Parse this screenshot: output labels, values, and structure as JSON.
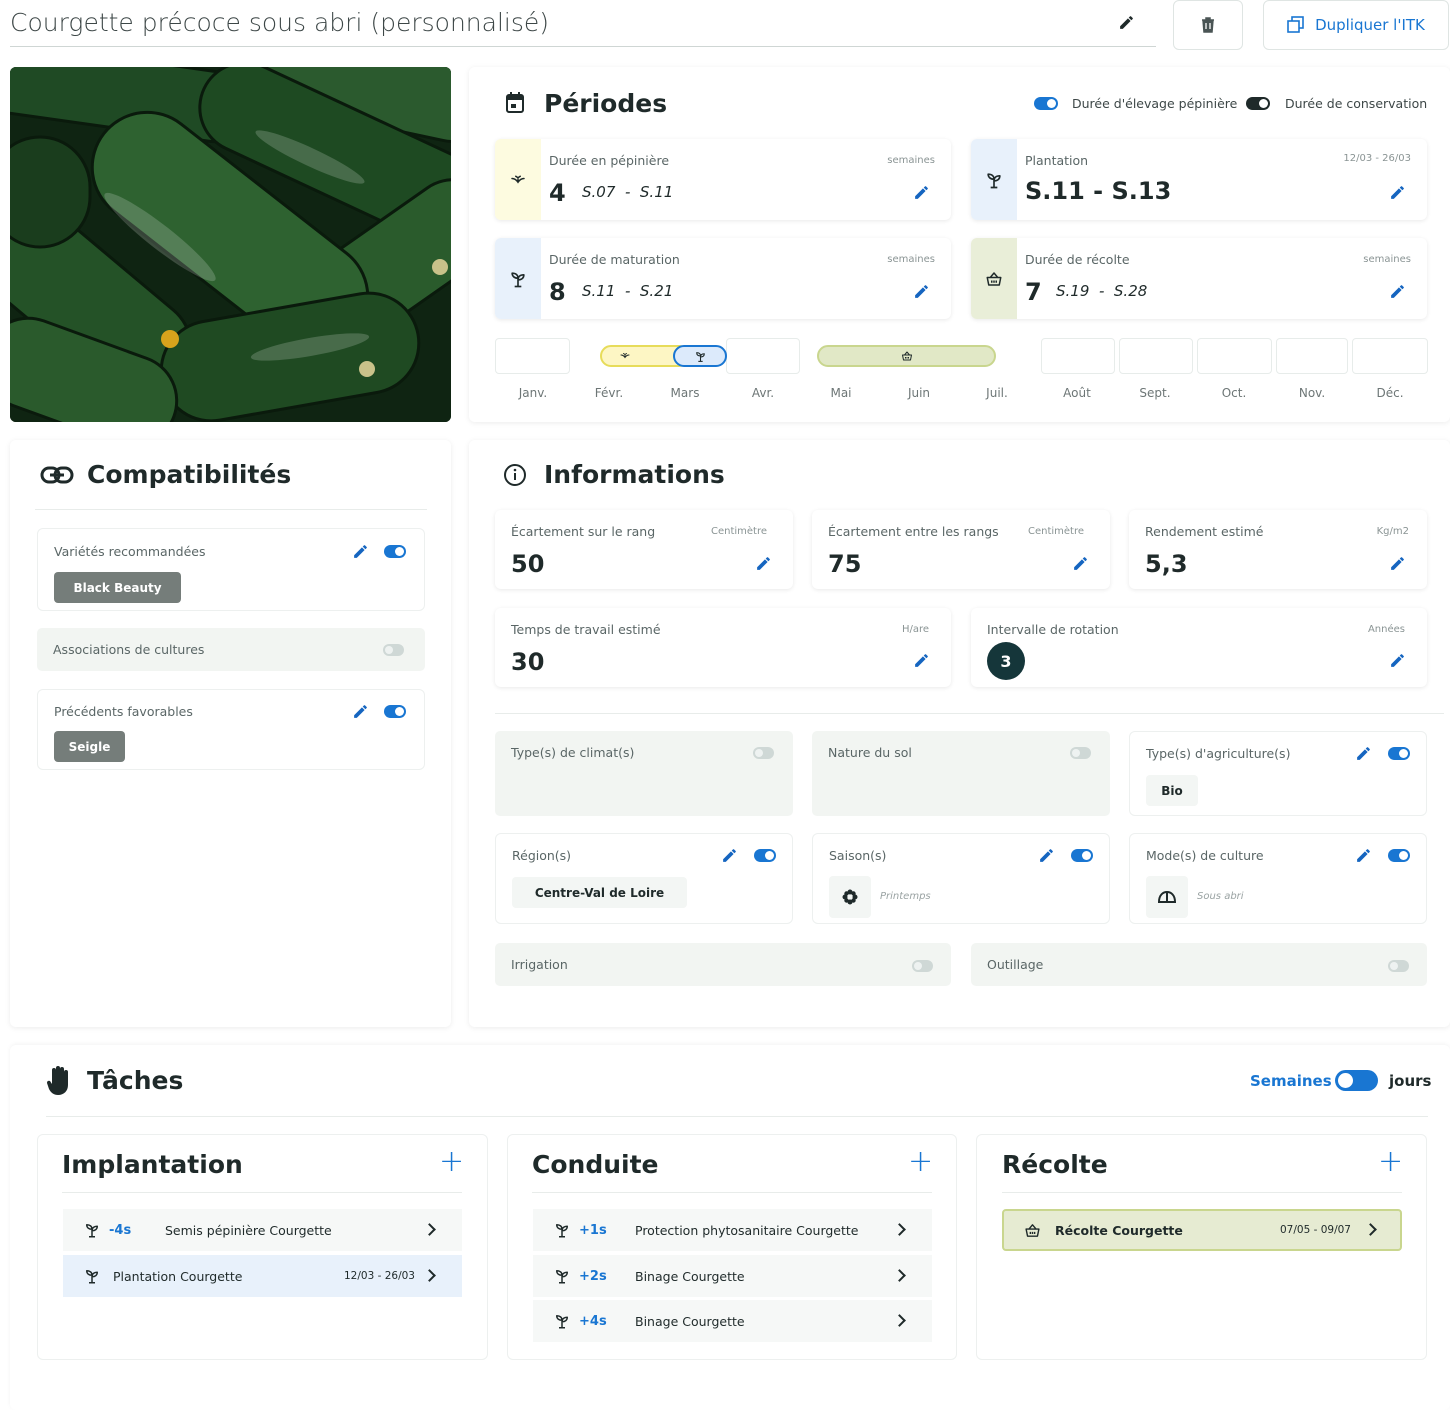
{
  "header": {
    "title": "Courgette précoce sous abri (personnalisé)",
    "duplicate_label": "Dupliquer l'ITK"
  },
  "periodes": {
    "title": "Périodes",
    "toggle_pepiniere": "Durée d'élevage pépinière",
    "toggle_conservation": "Durée de conservation",
    "cards": {
      "pepiniere": {
        "label": "Durée en pépinière",
        "unit": "semaines",
        "value": "4",
        "start": "S.07",
        "sep": "-",
        "end": "S.11"
      },
      "plantation": {
        "label": "Plantation",
        "dates": "12/03 - 26/03",
        "start": "S.11",
        "sep": "-",
        "end": "S.13"
      },
      "maturation": {
        "label": "Durée de maturation",
        "unit": "semaines",
        "value": "8",
        "start": "S.11",
        "sep": "-",
        "end": "S.21"
      },
      "recolte": {
        "label": "Durée de récolte",
        "unit": "semaines",
        "value": "7",
        "start": "S.19",
        "sep": "-",
        "end": "S.28"
      }
    },
    "months": [
      "Janv.",
      "Févr.",
      "Mars",
      "Avr.",
      "Mai",
      "Juin",
      "Juil.",
      "Août",
      "Sept.",
      "Oct.",
      "Nov.",
      "Déc."
    ]
  },
  "compat": {
    "title": "Compatibilités",
    "varietes_label": "Variétés recommandées",
    "varietes_chip": "Black Beauty",
    "associations_label": "Associations de cultures",
    "precedents_label": "Précédents favorables",
    "precedents_chip": "Seigle"
  },
  "infos": {
    "title": "Informations",
    "ecart_rang": {
      "label": "Écartement sur le rang",
      "unit": "Centimètre",
      "value": "50"
    },
    "ecart_rangs": {
      "label": "Écartement entre les rangs",
      "unit": "Centimètre",
      "value": "75"
    },
    "rendement": {
      "label": "Rendement estimé",
      "unit": "Kg/m2",
      "value": "5,3"
    },
    "temps": {
      "label": "Temps de travail estimé",
      "unit": "H/are",
      "value": "30"
    },
    "rotation": {
      "label": "Intervalle de rotation",
      "unit": "Années",
      "value": "3"
    },
    "climat_label": "Type(s) de climat(s)",
    "sol_label": "Nature du sol",
    "agri_label": "Type(s) d'agriculture(s)",
    "agri_chip": "Bio",
    "region_label": "Région(s)",
    "region_chip": "Centre-Val de Loire",
    "saison_label": "Saison(s)",
    "saison_value": "Printemps",
    "mode_label": "Mode(s) de culture",
    "mode_value": "Sous abri",
    "irrigation_label": "Irrigation",
    "outillage_label": "Outillage"
  },
  "taches": {
    "title": "Tâches",
    "toggle_left": "Semaines",
    "toggle_right": "jours",
    "implantation": {
      "title": "Implantation",
      "rows": [
        {
          "offset": "-4s",
          "name": "Semis pépinière Courgette",
          "dates": ""
        },
        {
          "offset": "",
          "name": "Plantation Courgette",
          "dates": "12/03 - 26/03"
        }
      ]
    },
    "conduite": {
      "title": "Conduite",
      "rows": [
        {
          "offset": "+1s",
          "name": "Protection phytosanitaire Courgette"
        },
        {
          "offset": "+2s",
          "name": "Binage Courgette"
        },
        {
          "offset": "+4s",
          "name": "Binage Courgette"
        }
      ]
    },
    "recolte": {
      "title": "Récolte",
      "rows": [
        {
          "name": "Récolte Courgette",
          "dates": "07/05 - 09/07"
        }
      ]
    }
  },
  "colors": {
    "accent": "#1976d2",
    "yellow": "#fdfbe0",
    "blue_light": "#e8f1fb",
    "green_light": "#e9eed8",
    "dark": "#1f2a2a"
  }
}
